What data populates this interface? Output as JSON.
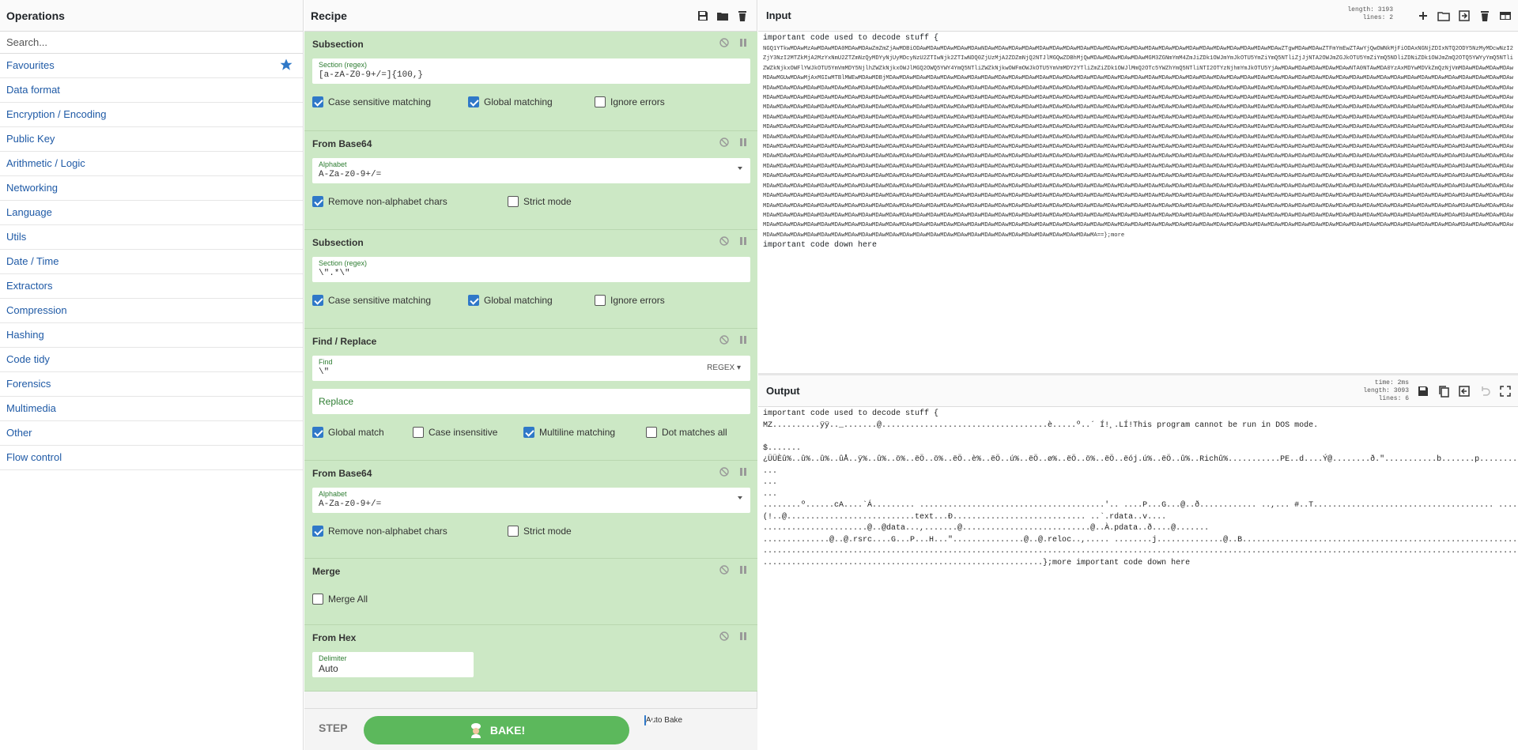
{
  "operations": {
    "title": "Operations",
    "search_placeholder": "Search...",
    "categories": [
      "Favourites",
      "Data format",
      "Encryption / Encoding",
      "Public Key",
      "Arithmetic / Logic",
      "Networking",
      "Language",
      "Utils",
      "Date / Time",
      "Extractors",
      "Compression",
      "Hashing",
      "Code tidy",
      "Forensics",
      "Multimedia",
      "Other",
      "Flow control"
    ]
  },
  "recipe": {
    "title": "Recipe",
    "ops": [
      {
        "title": "Subsection",
        "label": "Section (regex)",
        "value": "[a-zA-Z0-9+/=]{100,}",
        "checks": [
          [
            "Case sensitive matching",
            true
          ],
          [
            "Global matching",
            true
          ],
          [
            "Ignore errors",
            false
          ]
        ]
      },
      {
        "title": "From Base64",
        "label": "Alphabet",
        "value": "A-Za-z0-9+/=",
        "checks": [
          [
            "Remove non-alphabet chars",
            true
          ],
          [
            "Strict mode",
            false
          ]
        ]
      },
      {
        "title": "Subsection",
        "label": "Section (regex)",
        "value": "\\\".*\\\"",
        "checks": [
          [
            "Case sensitive matching",
            true
          ],
          [
            "Global matching",
            true
          ],
          [
            "Ignore errors",
            false
          ]
        ]
      },
      {
        "title": "Find / Replace",
        "find_label": "Find",
        "find_value": "\\\"",
        "regex": "REGEX",
        "replace_ph": "Replace",
        "checks": [
          [
            "Global match",
            true
          ],
          [
            "Case insensitive",
            false
          ],
          [
            "Multiline matching",
            true
          ],
          [
            "Dot matches all",
            false
          ]
        ]
      },
      {
        "title": "From Base64",
        "label": "Alphabet",
        "value": "A-Za-z0-9+/=",
        "checks": [
          [
            "Remove non-alphabet chars",
            true
          ],
          [
            "Strict mode",
            false
          ]
        ]
      },
      {
        "title": "Merge",
        "checks": [
          [
            "Merge All",
            false
          ]
        ]
      },
      {
        "title": "From Hex",
        "label": "Delimiter",
        "value": "Auto"
      }
    ],
    "step": "STEP",
    "bake": "BAKE!",
    "auto_bake": "Auto Bake"
  },
  "input": {
    "title": "Input",
    "stats": {
      "length_k": "length:",
      "length_v": "3193",
      "lines_k": "lines:",
      "lines_v": "2"
    },
    "line1": "important code used to decode stuff {",
    "base64": "NGQ1YTkwMDAwMzAwMDAwMDA0MDAwMDAwZmZmZjAwMDBiODAwMDAwMDAwMDAwMDAwNDAwMDAwMDAwMDAwMDAwMDAwMDAwMDAwMDAwMDAwMDAwMDAwMDAwMDAwMDAwMDAwMDAwMDAwMDAwMDAwMDAwMDAwZTgwMDAwMDAwZTFmYmEwZTAwYjQwOWNkMjFiODAxNGNjZDIxNTQ2ODY5NzMyMDcwNzI2ZjY3NzI2MTZkMjA2MzYxNmU2ZTZmNzQyMDYyNjUyMDcyNzU2ZTIwNjk2ZTIwNDQ0ZjUzMjA2ZDZmNjQ2NTJlMGQwZDBhMjQwMDAwMDAwMDAwMDAwMGM3ZGNmYmM4ZmJiZDk1OWJmYmJkOTU5YmZiYmQ5NTliZjJjNTA2OWJmZGJkOTU5YmZiYmQ5NDliZDNiZDk1OWJmZmQ2OTQ5YWYyYmQ5NTliZWZkNjkxOWFlYWJkOTU5YmVmMDY5NjlhZWZkNjkxOWJlMGQ2OWQ5YWY4YmQ5NTliZWZkNjkwOWFmOWJkOTU5YmVmMDY2YTliZmZiZDk1OWJlMmQ2OTc5YWZhYmQ5NTliNTI2OTYzNjhmYmJkOTU5YjAwMDAwMDAwMDAwMDAwMDAwNTA0NTAwMDA0YzAxMDYwMDVkZmQzNjVmMDAwMDAwMDAwMDAwMDAwMGUwMDAwMjAxMGIwMTBlMWEwMDAwMDBjMDAwMDAwMDAwMDAwMDAwMDAwMDAwMDAwMDAwMDAwMDAwMDAwMDAwMDAwMDAwMDAwMDAwMDAwMDAwMDAwMDAwMDAwMDAwMDAwMDAwMDAwMDAwMDAwMDAwMDAwMDAwMDAwMDAwMDAwMDAwMDAwMDAwMDAwMDAwMDAwMDAwMDAwMDAwMDAwMDAwMDAwMDAwMDAwMDAwMDAwMDAwMDAwMDAwMDAwMDAwMDAwMDAwMDAwMDAwMDAwMDAwMDAwMDAwMDAwMDAwMDAwMDAwMDAwMDAwMDAwMDAwMDAwMDAwMDAwMDAwMDAwMDAwMDAwMDAwMDAwMDAwMDAwMDAwMDAwMDAwMDAwMDAwMDAwMDAwMDAwMDAwMDAwMDAwMDAwMDAwMDAwMDAwMDAwMDAwMDAwMDAwMDAwMDAwMDAwMDAwMDAwMDAwMDAwMDAwMDAwMDAwMDAwMDAwMDAwMDAwMDAwMDAwMDAwMDAwMDAwMDAwMDAwMDAwMDAwMDAwMDAwMDAwMDAwMDAwMDAwMDAwMDAwMDAwMDAwMDAwMDAwMDAwMDAwMDAwMDAwMDAwMDAwMDAwMDAwMDAwMDAwMDAwMDAwMDAwMDAwMDAwMDAwMDAwMDAwMDAwMDAwMDAwMDAwMDAwMDAwMDAwMDAwMDAwMDAwMDAwMDAwMDAwMDAwMDAwMDAwMDAwMDAwMDAwMDAwMDAwMDAwMDAwMDAwMDAwMDAwMDAwMDAwMDAwMDAwMDAwMDAwMDAwMDAwMDAwMDAwMDAwMDAwMDAwMDAwMDAwMDAwMDAwMDAwMDAwMDAwMDAwMDAwMDAwMDAwMDAwMDAwMDAwMDAwMDAwMDAwMDAwMDAwMDAwMDAwMDAwMDAwMDAwMDAwMDAwMDAwMDAwMDAwMDAwMDAwMDAwMDAwMDAwMDAwMDAwMDAwMDAwMDAwMDAwMDAwMDAwMDAwMDAwMDAwMDAwMDAwMDAwMDAwMDAwMDAwMDAwMDAwMDAwMDAwMDAwMDAwMDAwMDAwMDAwMDAwMDAwMDAwMDAwMDAwMDAwMDAwMDAwMDAwMDAwMDAwMDAwMDAwMDAwMDAwMDAwMDAwMDAwMDAwMDAwMDAwMDAwMDAwMDAwMDAwMDAwMDAwMDAwMDAwMDAwMDAwMDAwMDAwMDAwMDAwMDAwMDAwMDAwMDAwMDAwMDAwMDAwMDAwMDAwMDAwMDAwMDAwMDAwMDAwMDAwMDAwMDAwMDAwMDAwMDAwMDAwMDAwMDAwMDAwMDAwMDAwMDAwMDAwMDAwMDAwMDAwMDAwMDAwMDAwMDAwMDAwMDAwMDAwMDAwMDAwMDAwMDAwMDAwMDAwMDAwMDAwMDAwMDAwMDAwMDAwMDAwMDAwMDAwMDAwMDAwMDAwMDAwMDAwMDAwMDAwMDAwMDAwMDAwMDAwMDAwMDAwMDAwMDAwMDAwMDAwMDAwMDAwMDAwMDAwMDAwMDAwMDAwMDAwMDAwMDAwMDAwMDAwMDAwMDAwMDAwMDAwMDAwMDAwMDAwMDAwMDAwMDAwMDAwMDAwMDAwMDAwMDAwMDAwMDAwMDAwMDAwMDAwMDAwMDAwMDAwMDAwMDAwMDAwMDAwMDAwMDAwMDAwMDAwMDAwMDAwMDAwMDAwMDAwMDAwMDAwMDAwMDAwMDAwMDAwMDAwMDAwMDAwMDAwMDAwMDAwMDAwMDAwMDAwMDAwMDAwMDAwMDAwMDAwMDAwMDAwMDAwMDAwMDAwMDAwMDAwMDAwMDAwMDAwMDAwMDAwMDAwMDAwMDAwMDAwMDAwMDAwMDAwMDAwMDAwMDAwMDAwMDAwMDAwMDAwMDAwMDAwMDAwMDAwMDAwMDAwMDAwMDAwMDAwMDAwMDAwMDAwMDAwMDAwMDAwMDAwMDAwMDAwMDAwMDAwMDAwMDAwMDAwMDAwMDAwMDAwMDAwMDAwMDAwMDAwMDAwMDAwMDAwMDAwMDAwMDAwMDAwMDAwMDAwMDAwMDAwMDAwMDAwMDAwMDAwMDAwMDAwMDAwMDAwMDAwMDAwMDAwMDAwMDAwMDAwMDAwMDAwMDAwMDAwMDAwMDAwMDAwMDAwMDAwMDAwMDAwMDAwMDAwMDAwMDAwMDAwMDAwMDAwMDAwMDAwMDAwMDAwMDAwMDAwMDAwMDAwMDAwMDAwMDAwMDAwMDAwMDAwMDAwMDAwMDAwMDAwMDAwMDAwMDAwMDAwMDAwMDAwMDAwMDAwMDAwMDAwMDAwMDAwMDAwMDAwMDAwMDAwMDAwMDAwMDAwMDAwMDAwMDAwMDAwMDAwMDAwMDAwMDAwMDAwMDAwMDAwMDAwMDAwMDAwMDAwMDAwMDAwMDAwMDAwMDAwMDAwMDAwMDAwMDAwMDAwMDAwMDAwMDAwMDAwMDAwMDAwMDAwMDAwMDAwMDAwMDAwMDAwMDAwMDAwMDAwMDAwMDAwMDAwMDAwMDAwMDAwMDAwMDAwMDAwMDAwMDAwMDAwMDAwMDAwMDAwMDAwMDAwMDAwMDAwMDAwMDAwMDAwMDAwMDAwMDAwMDAwMDAwMDAwMDAwMDAwMDAwMDAwMDAwMDAwMDAwMDAwMDAwMDAwMDAwMDAwMDAwMDAwMDAwMDAwMDAwMDAwMDAwMDAwMDAwMDAwMDAwMDAwMDAwMDAwMDAwMDAwMDAwMDAwMDAwMDAwMDAwMDAwMDAwMDAwMDAwMDAwMDAwMDAwMDAwMDAwMDAwMDAwMDAwMDAwMDAwMDAwMDAwMDAwMDAwMDAwMDAwMDAwMDAwMDAwMDAwMDAwMDAwMDAwMDAwMDAwMDAwMDAwMDAwMDAwMDAwMDAwMDAwMDAwMDAwMDAwMDAwMDAwMDAwMDAwMDAwMDAwMDAwMDAwMDAwMDAwMDAwMDAwMDAwMDAwMDAwMDAwMDAwMDAwMDAwMDAwMDAwMDAwMDAwMDAwMDAwMDAwMDAwMDAwMDAwMDAwMDAwMDAwMDAwMDAwMDAwMDAwMDAwMDAwMDAwMDAwMDAwMDAwMDAwMDAwMDAwMDAwMDAwMDAwMDAwMDAwMDAwMDAwMDAwMDAwMDAwMDAwMDAwMDAwMDAwMDAwMDAwMDAwMDAwMDAwMDAwMDAwMDAwMDAwMDAwMDAwMDAwMDAwMDAwMDAwMDAwMDAwMDAwMDAwMDAwMDAwMDAwMDAwMDAwMDAwMDAwMDAwMDAwMDAwMDAwMDAwMDAwMDAwMDAwMDAwMDAwMDAwMDAwMDAwMDAwMDAwMDAwMDAwMDAwMDAwMDAwMDAwMDAwMDAwMDAwMDAwMDAwMDAwMDAwMDAwMDAwMDAwMDAwMDAwMDAwMDAwMDAwMDAwMDAwMDAwMDAwMDAwMDAwMDAwMDAwMDAwMDAwMDAwMDAwMDAwMDAwMDAwMDAwMDAwMDAwMDAwMDAwMDAwMDAwMDAwMDAwMDAwMDAwMDAwMDAwMDAwMDAwMDAwMDAwMDAwMDAwMDAwMDAwMDAwMDAwMDAwMDAwMDAwMDAwMDAwMDAwMDAwMDAwMDAwMDAwMDAwMDAwMDAwMDAwMDAwMDAwMDAwMDAwMDAwMDAwMDAwMDAwMDAwMDAwMDAwMDAwMDAwMDAwMDAwMDAwMDAwMDAwMDAwMDAwMA==};more",
    "line3": "important code down here"
  },
  "output": {
    "title": "Output",
    "stats": {
      "time_k": "time:",
      "time_v": "2ms",
      "length_k": "length:",
      "length_v": "3093",
      "lines_k": "lines:",
      "lines_v": "6"
    },
    "text": "important code used to decode stuff {\nMZ..........ÿÿ.._.......@...................................è.....º..´ Í!¸.LÍ!This program cannot be run in DOS mode.\n\n$.......\n¿ÜÜÈû%..û%..û%..ûÅ..ÿ%..û%..ö%..ëÖ..ö%..ëÖ..è%..ëÖ..ú%..ëÖ..ø%..ëÖ..ö%..ëÖ..ëój.ú%..ëÖ..û%..Richû%...........PE..d....Ý@........ð.\"...........b.......p...........@..........\n...\n...\n...\n........º......cA....`Á......... .......................................'.. ....P...G...@..ð............ ..,... #..T...................................... ..............\n(!..@...........................text...Ð............................ ..`.rdata..v....\n......................@..@data...,.......@...........................@..À.pdata..ð....@.......\n..............@..@.rsrc....G...P...H...\"...............@..@.reloc..,..... ........j..............@..B..............................................................\n.......................................................................................................................................................................\n...........................................................};more important code down here"
  }
}
